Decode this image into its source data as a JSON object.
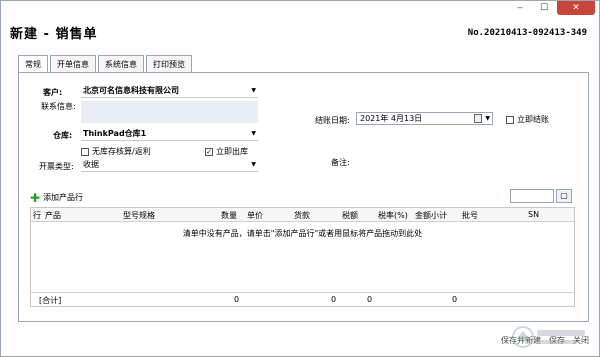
{
  "window": {
    "title": "新建 - 销售单",
    "doc_no": "No.20210413-092413-349",
    "min": "‒",
    "max": "☐",
    "close": "✕"
  },
  "tabs": [
    {
      "label": "常规"
    },
    {
      "label": "开单信息"
    },
    {
      "label": "系统信息"
    },
    {
      "label": "打印预览"
    }
  ],
  "form": {
    "customer_label": "客户:",
    "customer_value": "北京可名信息科技有限公司",
    "contact_label": "联系信息:",
    "warehouse_label": "仓库:",
    "warehouse_value": "ThinkPad仓库1",
    "no_stock_check": "无库存核算/返利",
    "immediate_out": "立即出库",
    "invoice_label": "开票类型:",
    "invoice_value": "收据",
    "settle_date_label": "结账日期:",
    "settle_date_value": "2021年 4月13日",
    "immediate_settle": "立即结账",
    "note_label": "备注:"
  },
  "items": {
    "add_label": "添加产品行",
    "search_btn": "▢",
    "columns": [
      "行",
      "产品",
      "型号规格",
      "数量",
      "单价",
      "货款",
      "税额",
      "税率(%)",
      "金额小计",
      "批号",
      "SN"
    ],
    "empty_text": "清单中没有产品，请单击\"添加产品行\"或者用鼠标将产品拖动到此处",
    "footer": {
      "total_label": "[合计]",
      "qty": "0",
      "goods": "0",
      "tax": "0",
      "subtotal": "0"
    }
  },
  "actions": {
    "save_new": "保存并新建",
    "save": "保存",
    "close": "关闭"
  },
  "colors": {
    "accent": "#2e9d2e",
    "close_btn": "#c8453a",
    "border": "#9aa5b5"
  }
}
